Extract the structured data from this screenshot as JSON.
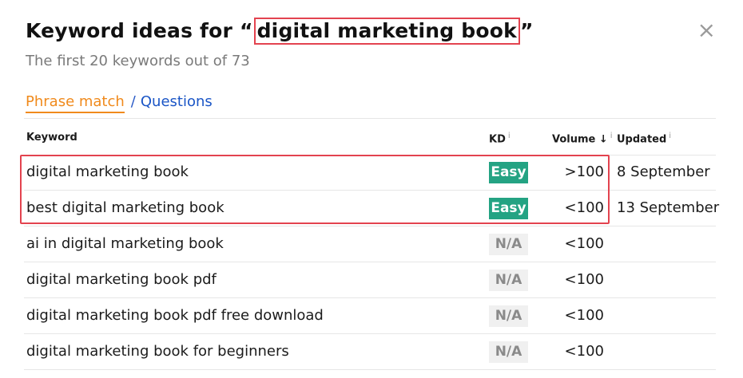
{
  "header": {
    "title_prefix": "Keyword ideas for “",
    "title_query": "digital marketing book",
    "title_suffix": "”",
    "subtitle": "The first 20 keywords out of 73",
    "close_symbol": "×"
  },
  "tabs": {
    "active": "Phrase match",
    "separator": "/",
    "other": "Questions"
  },
  "table": {
    "headers": {
      "keyword": "Keyword",
      "kd": "KD",
      "kd_info": "i",
      "volume": "Volume ↓",
      "volume_info": "i",
      "updated": "Updated",
      "updated_info": "i"
    },
    "rows": [
      {
        "keyword": "digital marketing book",
        "kd": "Easy",
        "kd_type": "easy",
        "volume": ">100",
        "updated": "8 September"
      },
      {
        "keyword": "best digital marketing book",
        "kd": "Easy",
        "kd_type": "easy",
        "volume": "<100",
        "updated": "13 September"
      },
      {
        "keyword": "ai in digital marketing book",
        "kd": "N/A",
        "kd_type": "na",
        "volume": "<100",
        "updated": ""
      },
      {
        "keyword": "digital marketing book pdf",
        "kd": "N/A",
        "kd_type": "na",
        "volume": "<100",
        "updated": ""
      },
      {
        "keyword": "digital marketing book pdf free download",
        "kd": "N/A",
        "kd_type": "na",
        "volume": "<100",
        "updated": ""
      },
      {
        "keyword": "digital marketing book for beginners",
        "kd": "N/A",
        "kd_type": "na",
        "volume": "<100",
        "updated": ""
      }
    ]
  },
  "colors": {
    "accent_orange": "#f08a1c",
    "link_blue": "#1a55c6",
    "easy_green": "#24a383",
    "highlight_red": "#e3434f"
  }
}
